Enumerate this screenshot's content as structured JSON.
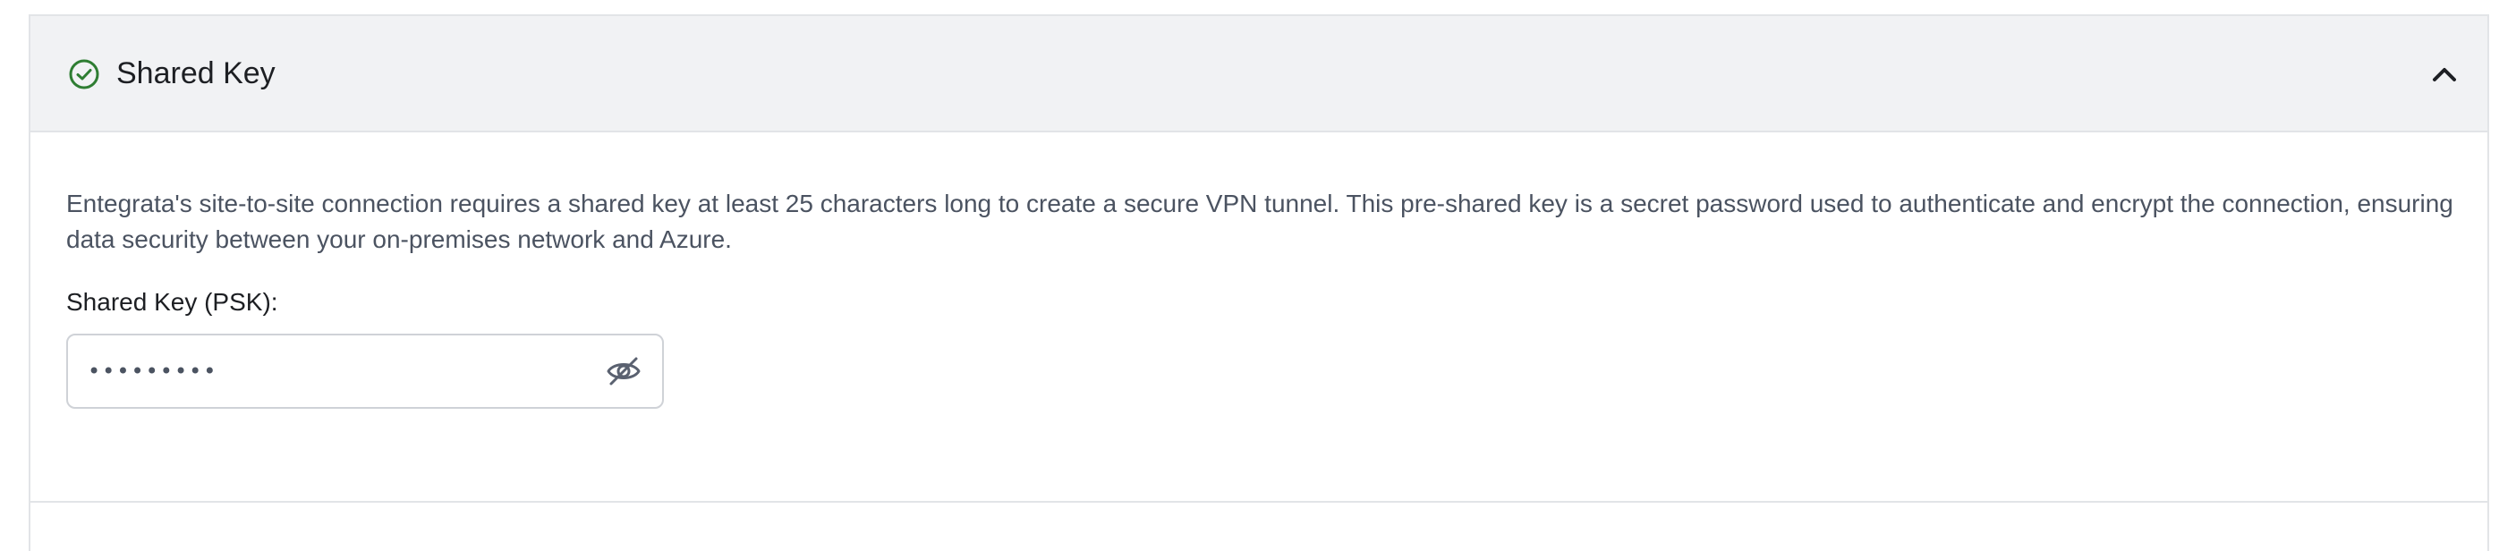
{
  "section": {
    "title": "Shared Key",
    "status_icon": "check-circle-icon",
    "status_color": "#2e7d32",
    "collapse_icon": "chevron-up-icon",
    "description": "Entegrata's site-to-site connection requires a shared key at least 25 characters long to create a secure VPN tunnel. This pre-shared key is a secret password used to authenticate and encrypt the connection, ensuring data security between your on-premises network and Azure."
  },
  "psk_field": {
    "label": "Shared Key (PSK):",
    "masked_value": "•••••••••",
    "visibility_icon": "eye-off-icon"
  }
}
